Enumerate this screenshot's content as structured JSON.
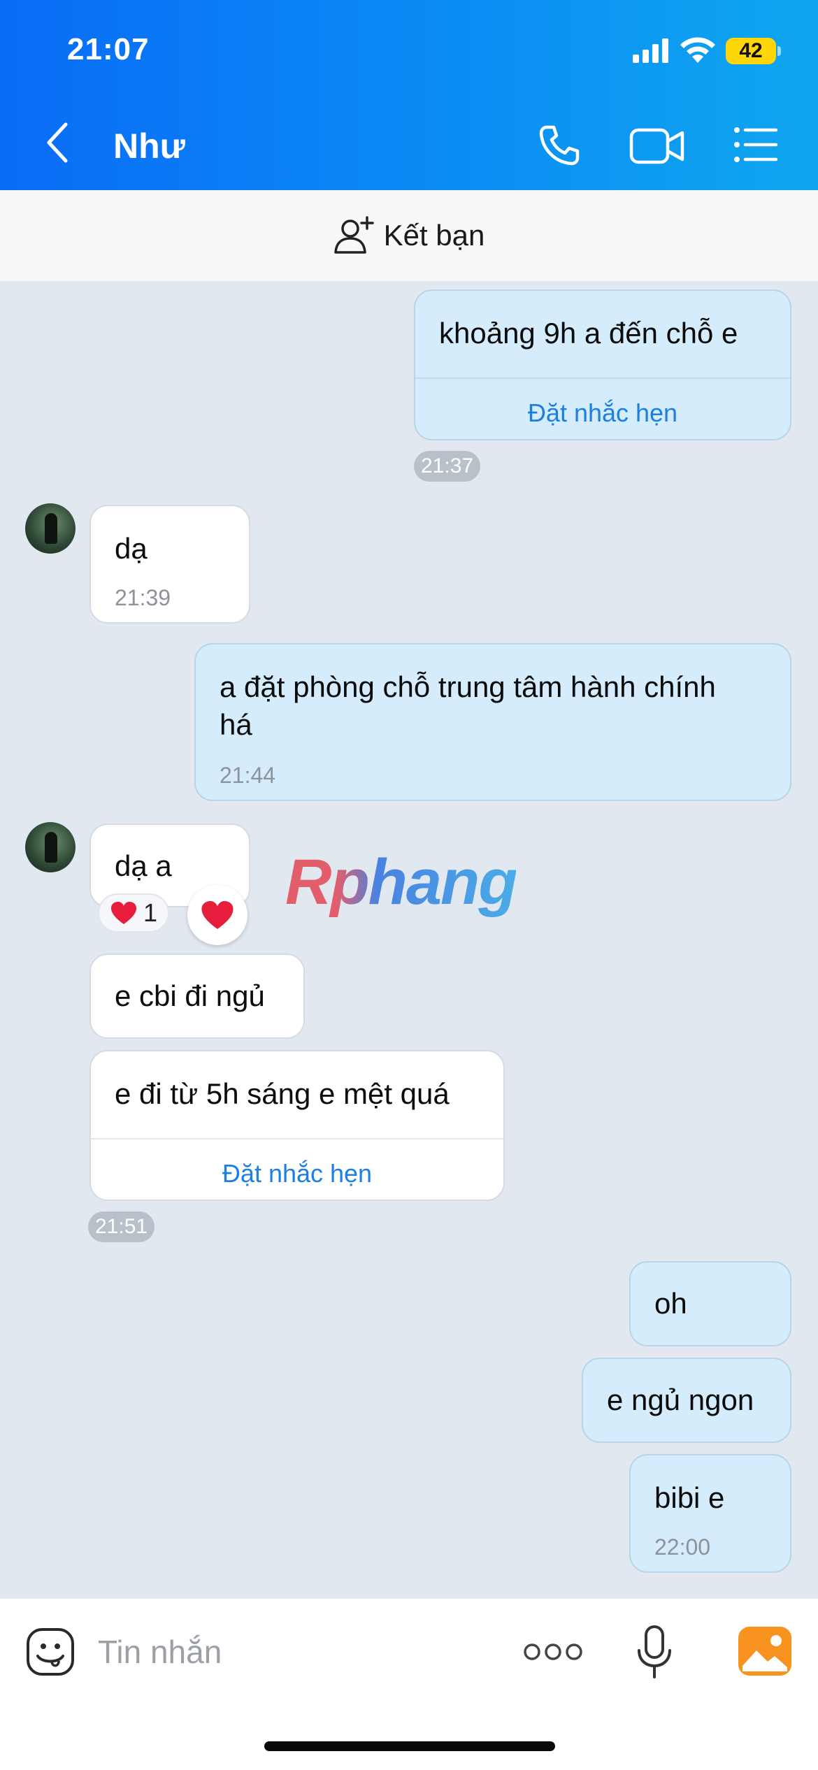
{
  "status_bar": {
    "time": "21:07",
    "battery": "42"
  },
  "header": {
    "contact_name": "Như"
  },
  "add_friend": {
    "label": "Kết bạn"
  },
  "messages": {
    "m1": {
      "text": "khoảng 9h a đến chỗ e",
      "reminder": "Đặt nhắc hẹn",
      "time": "21:37"
    },
    "m2": {
      "text": "dạ",
      "time": "21:39"
    },
    "m3": {
      "line1": "a đặt phòng chỗ trung tâm hành chính",
      "line2": "há",
      "time": "21:44"
    },
    "m4": {
      "text": "dạ a",
      "reaction_count": "1"
    },
    "m5": {
      "text": "e cbi đi ngủ"
    },
    "m6": {
      "text": "e đi từ 5h sáng e mệt quá",
      "reminder": "Đặt nhắc hẹn",
      "time": "21:51"
    },
    "m7": {
      "text": "oh"
    },
    "m8": {
      "text": "e ngủ ngon"
    },
    "m9": {
      "text": "bibi e",
      "time": "22:00"
    }
  },
  "watermark": {
    "text": "Rphang"
  },
  "composer": {
    "placeholder": "Tin nhắn"
  },
  "icons": {
    "back": "chevron-left-icon",
    "call": "phone-icon",
    "video": "video-camera-icon",
    "menu": "list-menu-icon",
    "add_friend": "add-user-icon",
    "sticker": "sticker-face-icon",
    "more": "more-dots-icon",
    "mic": "microphone-icon",
    "image": "image-gallery-icon",
    "reaction": "heart-icon"
  },
  "colors": {
    "header_start": "#0a6cf6",
    "header_end": "#0fa6ef",
    "outgoing_bubble": "#d4ecfb",
    "incoming_bubble": "#ffffff",
    "chat_bg": "#e2e8f0",
    "link": "#1d7fe0",
    "battery": "#ffd60a"
  }
}
